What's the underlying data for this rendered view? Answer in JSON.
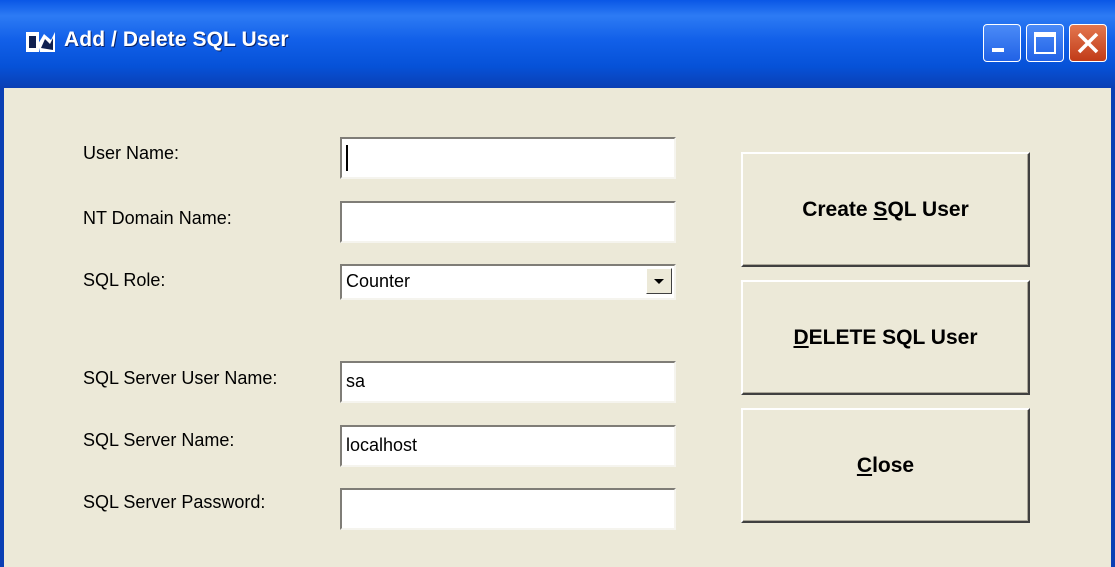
{
  "window": {
    "title": "Add / Delete SQL User",
    "icon": "app-icon",
    "controls": [
      "minimize",
      "maximize",
      "close"
    ]
  },
  "form": {
    "user_name_label": "User Name:",
    "user_name_value": "",
    "nt_domain_label": "NT Domain Name:",
    "nt_domain_value": "",
    "sql_role_label": "SQL Role:",
    "sql_role_value": "Counter",
    "sql_server_user_label": "SQL Server User Name:",
    "sql_server_user_value": "sa",
    "sql_server_name_label": "SQL Server Name:",
    "sql_server_name_value": "localhost",
    "sql_server_password_label": "SQL Server Password:",
    "sql_server_password_value": ""
  },
  "buttons": {
    "create": {
      "before": "Create ",
      "mnemonic": "S",
      "after": "QL User"
    },
    "delete": {
      "before": "",
      "mnemonic": "D",
      "after": "ELETE SQL User"
    },
    "close": {
      "before": "",
      "mnemonic": "C",
      "after": "lose"
    }
  },
  "colors": {
    "titlebar": "#0A57E6",
    "dialog_bg": "#ECE9D8",
    "close_button": "#C13B18"
  }
}
